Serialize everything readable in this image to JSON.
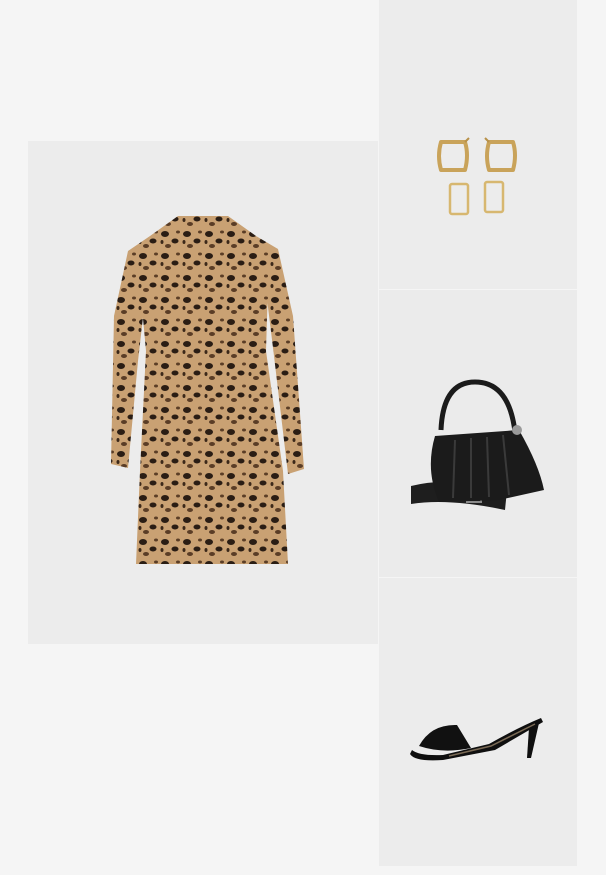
{
  "board": {
    "background": "#f5f5f5",
    "tile_background": "#ececec"
  },
  "items": [
    {
      "name": "leopard-print-dress",
      "colors": [
        "#c79f72",
        "#2a1d14",
        "#6b4a30"
      ]
    },
    {
      "name": "gold-earrings",
      "colors": [
        "#c9a35a",
        "#e8cf8c"
      ]
    },
    {
      "name": "black-handbag",
      "colors": [
        "#1b1b1b",
        "#3a3a3a"
      ]
    },
    {
      "name": "black-mule-sandal",
      "colors": [
        "#0f0f0f",
        "#7a6a55"
      ]
    }
  ]
}
